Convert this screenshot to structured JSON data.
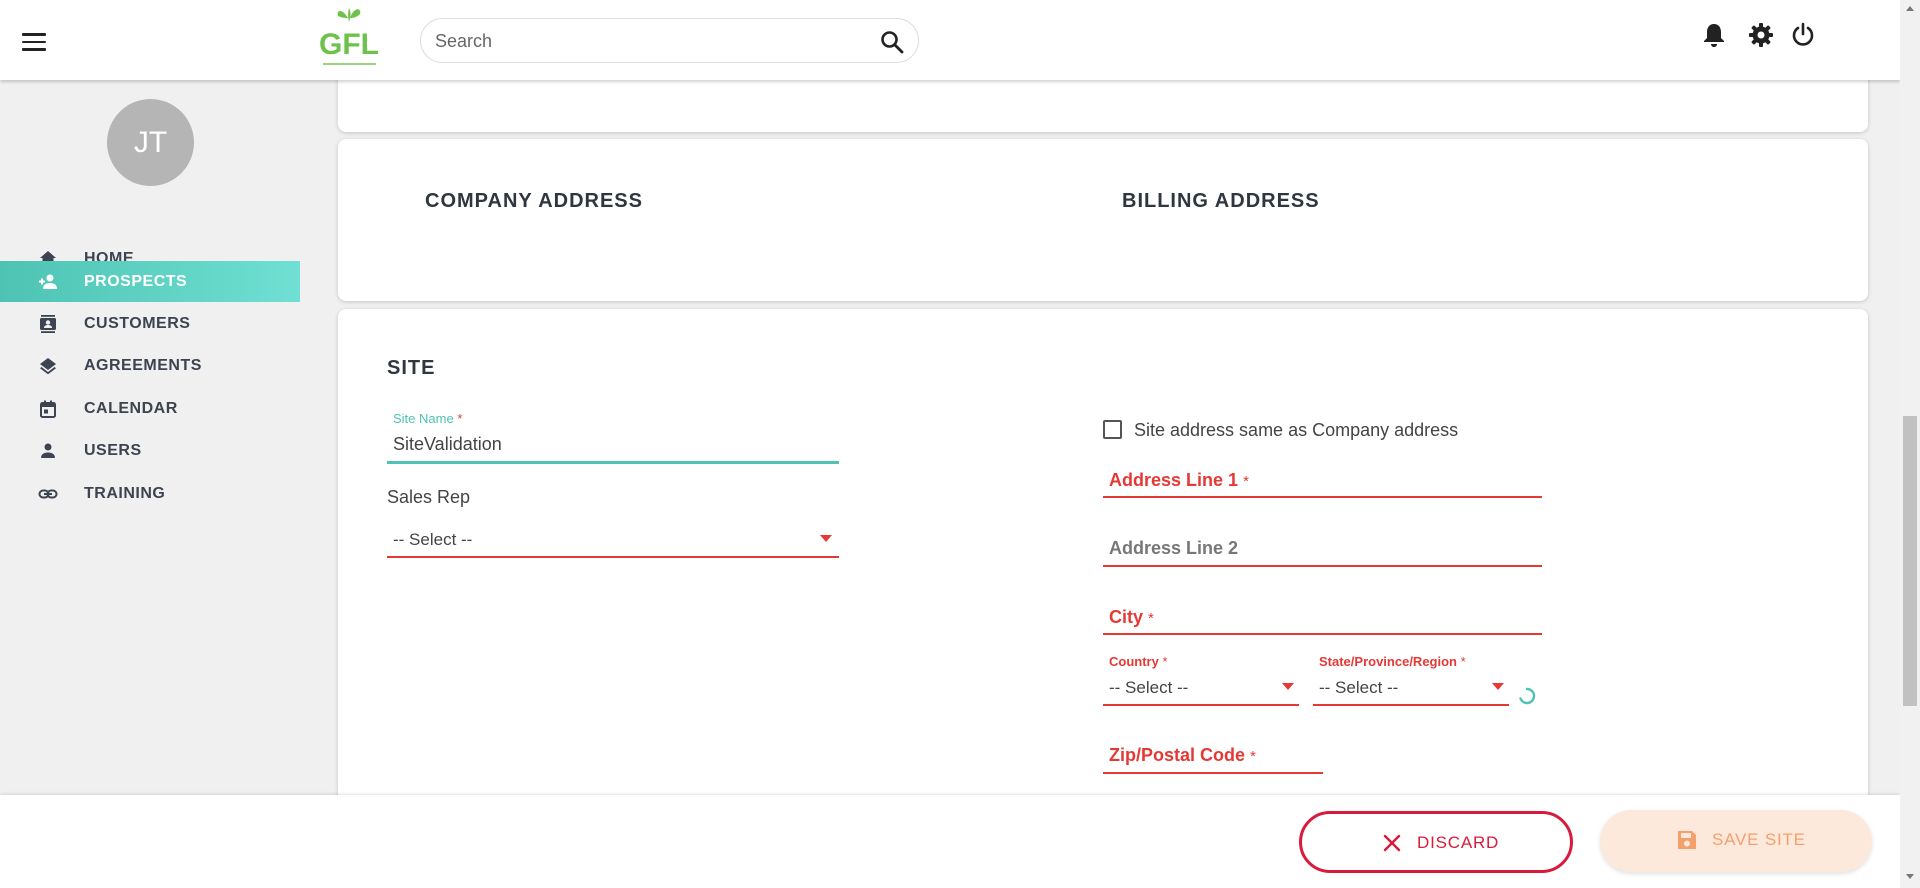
{
  "header": {
    "logo_text": "GFL",
    "search_placeholder": "Search",
    "icons": [
      "menu-icon",
      "search-icon",
      "bell-icon",
      "gear-icon",
      "power-icon"
    ]
  },
  "sidebar": {
    "avatar_initials": "JT",
    "items": [
      {
        "label": "HOME",
        "icon": "home-icon",
        "active": false
      },
      {
        "label": "PROSPECTS",
        "icon": "person-add-icon",
        "active": true
      },
      {
        "label": "CUSTOMERS",
        "icon": "contacts-icon",
        "active": false
      },
      {
        "label": "AGREEMENTS",
        "icon": "layers-icon",
        "active": false
      },
      {
        "label": "CALENDAR",
        "icon": "calendar-icon",
        "active": false
      },
      {
        "label": "USERS",
        "icon": "person-icon",
        "active": false
      },
      {
        "label": "TRAINING",
        "icon": "link-icon",
        "active": false
      }
    ],
    "active_color": "#4ec3b3"
  },
  "address_section": {
    "company_title": "COMPANY ADDRESS",
    "billing_title": "BILLING ADDRESS"
  },
  "site": {
    "title": "SITE",
    "site_name_label": "Site Name",
    "site_name_value": "SiteValidation",
    "sales_rep_label": "Sales Rep",
    "sales_rep_value": "-- Select --",
    "same_address_label": "Site address same as Company address",
    "same_address_checked": false,
    "address_line1_label": "Address Line 1",
    "address_line2_label": "Address Line 2",
    "city_label": "City",
    "country_label": "Country",
    "country_value": "-- Select --",
    "state_label": "State/Province/Region",
    "state_value": "-- Select --",
    "zip_label": "Zip/Postal Code",
    "required_mark": "*"
  },
  "actions": {
    "discard_label": "DISCARD",
    "save_label": "SAVE SITE"
  },
  "colors": {
    "accent": "#4ec3b3",
    "error": "#e53935",
    "discard": "#d81b3c",
    "save_bg": "#fde9dc",
    "save_text": "#f4a06b"
  }
}
